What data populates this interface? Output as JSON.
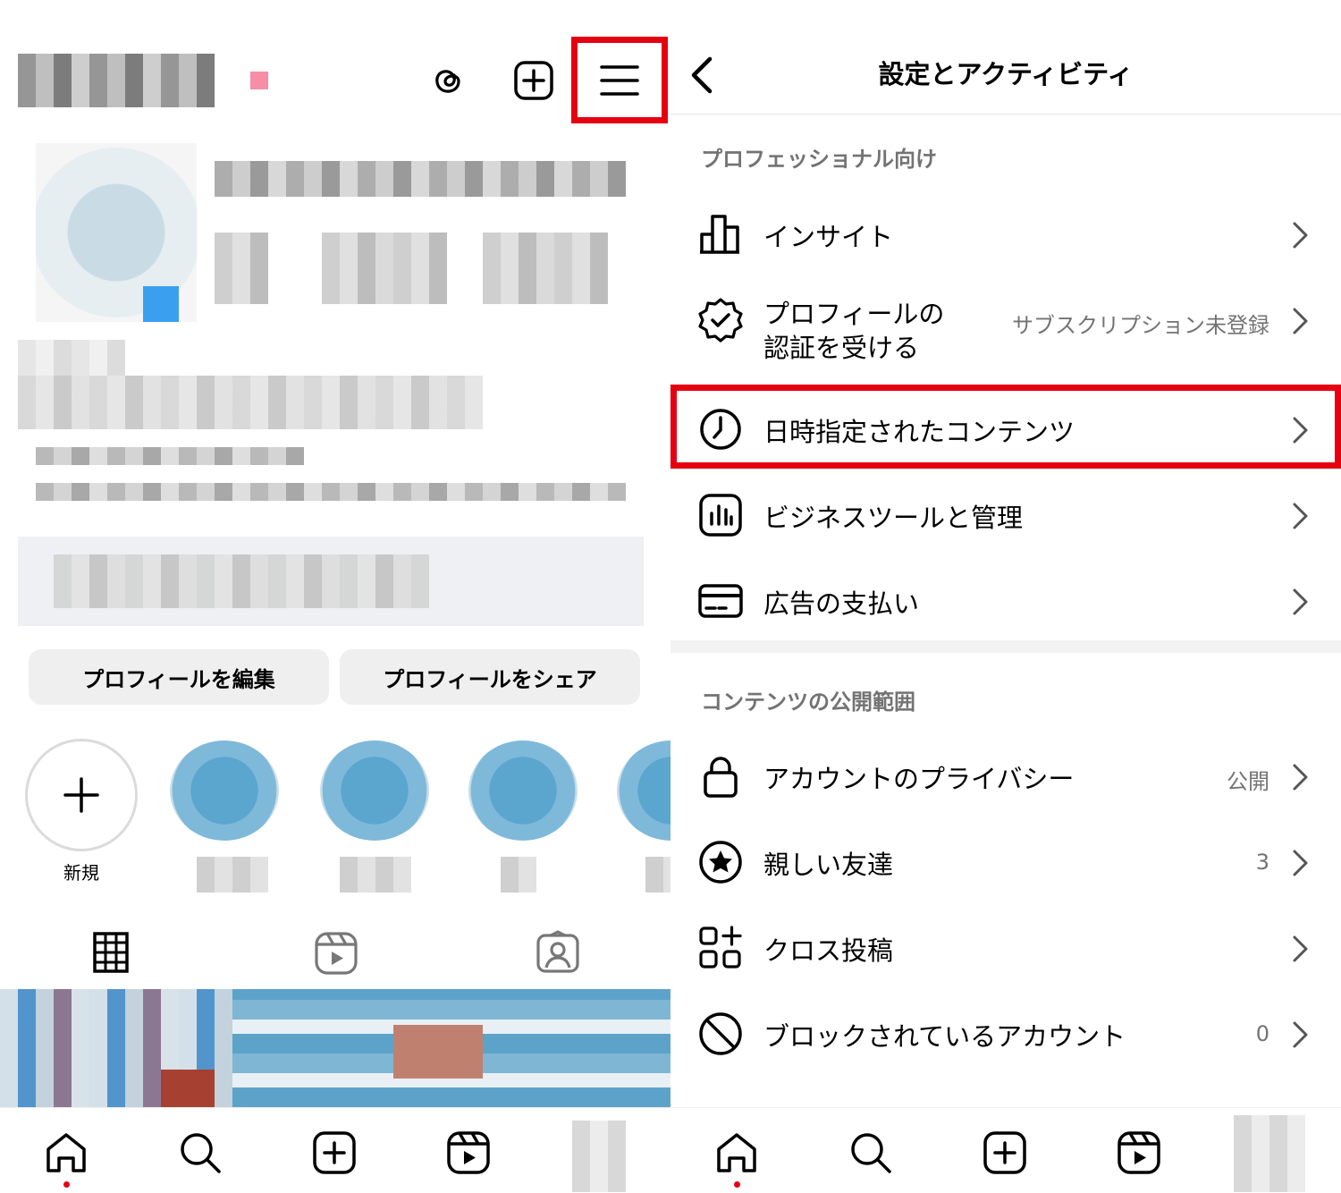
{
  "left": {
    "profile": {
      "edit_button": "プロフィールを編集",
      "share_button": "プロフィールをシェア"
    },
    "highlights": {
      "new_label": "新規"
    }
  },
  "right": {
    "header": {
      "title": "設定とアクティビティ"
    },
    "sections": [
      {
        "title": "プロフェッショナル向け",
        "items": [
          {
            "label": "インサイト",
            "value": ""
          },
          {
            "label": "プロフィールの\n認証を受ける",
            "value": "サブスクリプション未登録"
          },
          {
            "label": "日時指定されたコンテンツ",
            "value": ""
          },
          {
            "label": "ビジネスツールと管理",
            "value": ""
          },
          {
            "label": "広告の支払い",
            "value": ""
          }
        ]
      },
      {
        "title": "コンテンツの公開範囲",
        "items": [
          {
            "label": "アカウントのプライバシー",
            "value": "公開"
          },
          {
            "label": "親しい友達",
            "value": "3"
          },
          {
            "label": "クロス投稿",
            "value": ""
          },
          {
            "label": "ブロックされているアカウント",
            "value": "0"
          }
        ]
      }
    ]
  },
  "colors": {
    "highlight_red": "#e50012",
    "secondary_text": "#737373",
    "button_bg": "#efefef"
  },
  "icons": {
    "left_top": [
      "threads-icon",
      "create-icon",
      "menu-icon"
    ],
    "profile_tabs": [
      "grid-icon",
      "reels-icon",
      "tagged-icon"
    ],
    "bottom_nav": [
      "home-icon",
      "search-icon",
      "create-icon",
      "reels-icon",
      "profile-avatar"
    ]
  }
}
